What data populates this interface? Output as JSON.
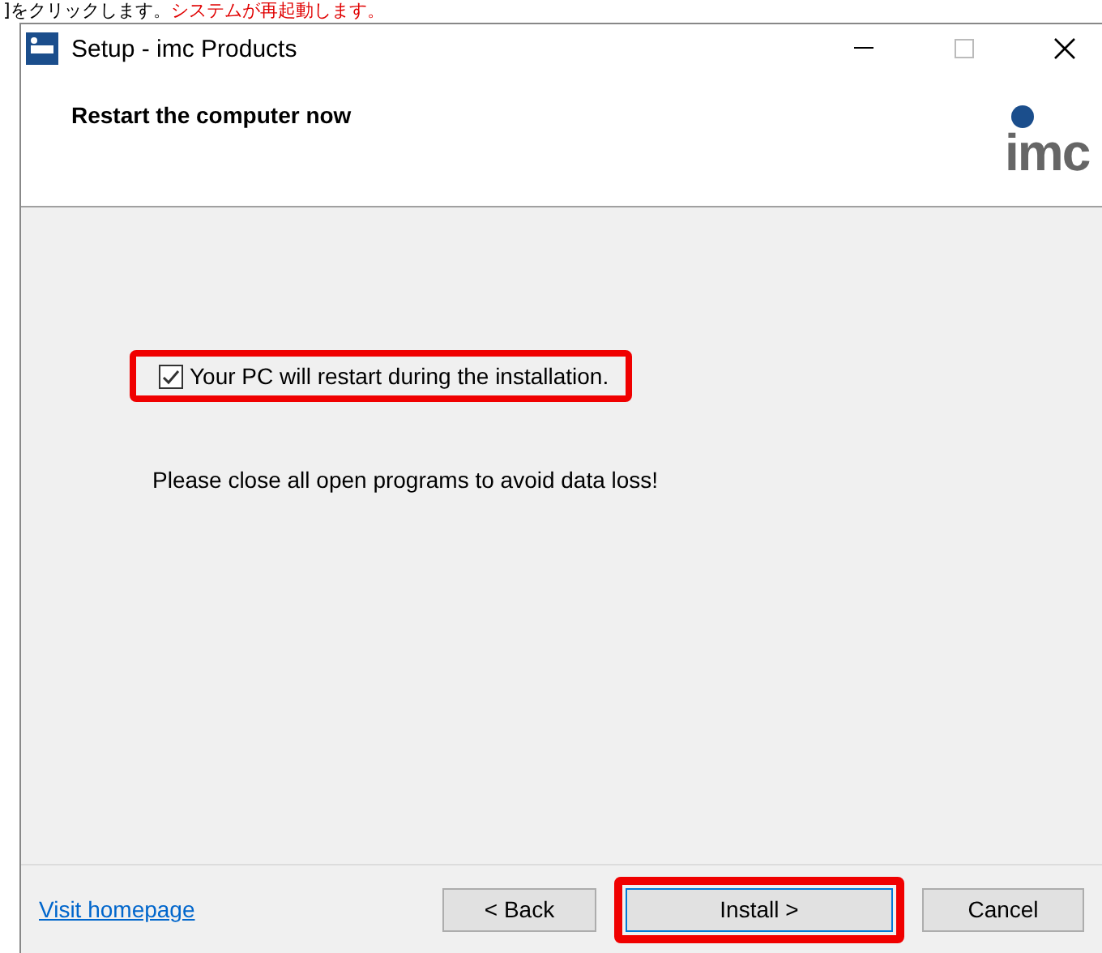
{
  "caption": [
    {
      "text": "]をクリックします。",
      "kind": "plain"
    },
    {
      "text": "システムが再起動します。",
      "kind": "emphasis"
    }
  ],
  "window": {
    "title": "Setup - imc Products"
  },
  "header": {
    "title": "Restart the computer now",
    "logo": "imc"
  },
  "restart_option": {
    "label": "Your PC will restart during the installation.",
    "checked": true,
    "highlighted": true
  },
  "message": "Please close all open programs to avoid data loss!",
  "footer": {
    "link": "Visit homepage",
    "buttons": [
      {
        "label": "< Back",
        "highlighted": false,
        "default": false
      },
      {
        "label": "Install >",
        "highlighted": true,
        "default": true
      },
      {
        "label": "Cancel",
        "highlighted": false,
        "default": false
      }
    ]
  }
}
